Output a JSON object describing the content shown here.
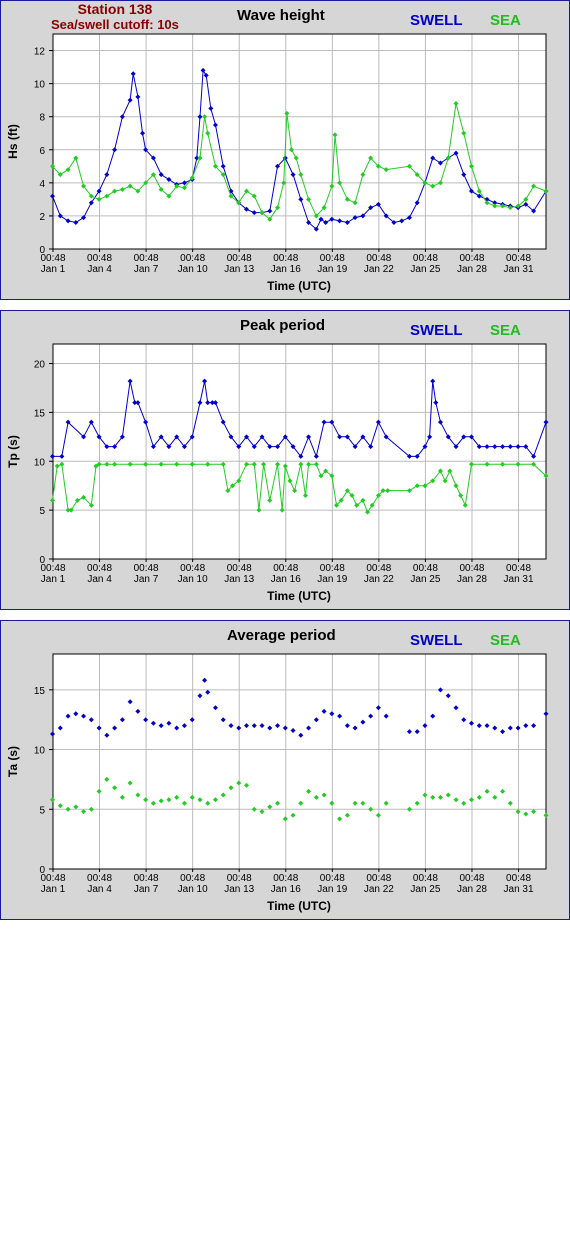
{
  "header": {
    "station": "Station 138",
    "cutoff": "Sea/swell cutoff: 10s"
  },
  "legend": {
    "swell": "SWELL",
    "sea": "SEA",
    "swell_color": "#0000cc",
    "sea_color": "#22bb22"
  },
  "colors": {
    "swell": "#0000cc",
    "sea": "#22cc22",
    "frame": "#1a1a99",
    "panel_bg": "#d6d6d6",
    "plot_bg": "#ffffff",
    "grid": "#bbbbbb"
  },
  "x_ticks": [
    {
      "time": "00:48",
      "date": "Jan 1"
    },
    {
      "time": "00:48",
      "date": "Jan 4"
    },
    {
      "time": "00:48",
      "date": "Jan 7"
    },
    {
      "time": "00:48",
      "date": "Jan 10"
    },
    {
      "time": "00:48",
      "date": "Jan 13"
    },
    {
      "time": "00:48",
      "date": "Jan 16"
    },
    {
      "time": "00:48",
      "date": "Jan 19"
    },
    {
      "time": "00:48",
      "date": "Jan 22"
    },
    {
      "time": "00:48",
      "date": "Jan 25"
    },
    {
      "time": "00:48",
      "date": "Jan 28"
    },
    {
      "time": "00:48",
      "date": "Jan 31"
    }
  ],
  "chart_data": [
    {
      "type": "line",
      "title": "Wave height",
      "xlabel": "Time (UTC)",
      "ylabel": "Hs (ft)",
      "ylim": [
        0,
        13
      ],
      "yticks": [
        0,
        2,
        4,
        6,
        8,
        10,
        12
      ],
      "xlim": [
        1.03,
        32.8
      ],
      "grid": true,
      "series": [
        {
          "name": "SWELL",
          "x": [
            1.0,
            1.5,
            2.0,
            2.5,
            3.0,
            3.5,
            4.0,
            4.5,
            5.0,
            5.5,
            6.0,
            6.2,
            6.5,
            6.8,
            7.0,
            7.5,
            8.0,
            8.5,
            9.0,
            9.5,
            10.0,
            10.3,
            10.5,
            10.7,
            10.9,
            11.2,
            11.5,
            12.0,
            12.5,
            13.0,
            13.5,
            14.0,
            14.5,
            15.0,
            15.5,
            16.0,
            16.5,
            17.0,
            17.5,
            18.0,
            18.3,
            18.6,
            19.0,
            19.5,
            20.0,
            20.5,
            21.0,
            21.5,
            22.0,
            22.5,
            23.0,
            23.5,
            24.0,
            24.5,
            25.0,
            25.5,
            26.0,
            26.5,
            27.0,
            27.5,
            28.0,
            28.5,
            29.0,
            29.5,
            30.0,
            30.5,
            31.0,
            31.5,
            32.0,
            32.8
          ],
          "y": [
            3.2,
            2.0,
            1.7,
            1.6,
            1.9,
            2.8,
            3.5,
            4.5,
            6.0,
            8.0,
            9.0,
            10.6,
            9.2,
            7.0,
            6.0,
            5.5,
            4.5,
            4.2,
            3.9,
            4.0,
            4.2,
            5.5,
            8.0,
            10.8,
            10.5,
            8.5,
            7.5,
            5.0,
            3.5,
            2.8,
            2.4,
            2.2,
            2.2,
            2.3,
            5.0,
            5.5,
            4.5,
            3.0,
            1.6,
            1.2,
            1.8,
            1.6,
            1.8,
            1.7,
            1.6,
            1.9,
            2.0,
            2.5,
            2.7,
            2.0,
            1.6,
            1.7,
            1.9,
            2.8,
            4.0,
            5.5,
            5.2,
            5.5,
            5.8,
            4.5,
            3.5,
            3.2,
            3.0,
            2.8,
            2.7,
            2.6,
            2.5,
            2.7,
            2.3,
            3.5
          ]
        },
        {
          "name": "SEA",
          "x": [
            1.0,
            1.5,
            2.0,
            2.5,
            3.0,
            3.5,
            4.0,
            4.5,
            5.0,
            5.5,
            6.0,
            6.5,
            7.0,
            7.5,
            8.0,
            8.5,
            9.0,
            9.5,
            10.0,
            10.5,
            10.8,
            11.0,
            11.5,
            12.0,
            12.5,
            13.0,
            13.5,
            14.0,
            14.5,
            15.0,
            15.5,
            15.9,
            16.1,
            16.4,
            16.7,
            17.0,
            17.5,
            18.0,
            18.5,
            19.0,
            19.2,
            19.5,
            20.0,
            20.5,
            21.0,
            21.5,
            22.0,
            22.5,
            24.0,
            24.5,
            25.0,
            25.5,
            26.0,
            26.5,
            27.0,
            27.5,
            28.0,
            28.5,
            29.0,
            29.5,
            30.0,
            30.5,
            31.0,
            31.5,
            32.0,
            32.8
          ],
          "y": [
            5.0,
            4.5,
            4.8,
            5.5,
            3.8,
            3.2,
            3.0,
            3.2,
            3.5,
            3.6,
            3.8,
            3.5,
            4.0,
            4.5,
            3.6,
            3.2,
            3.8,
            3.7,
            4.3,
            5.5,
            8.0,
            7.0,
            5.0,
            4.5,
            3.2,
            2.8,
            3.5,
            3.2,
            2.2,
            1.8,
            2.5,
            4.0,
            8.2,
            6.0,
            5.5,
            4.5,
            3.0,
            2.0,
            2.5,
            3.8,
            6.9,
            4.0,
            3.0,
            2.8,
            4.5,
            5.5,
            5.0,
            4.8,
            5.0,
            4.5,
            4.0,
            3.8,
            4.0,
            5.5,
            8.8,
            7.0,
            5.0,
            3.5,
            2.8,
            2.6,
            2.6,
            2.5,
            2.6,
            3.0,
            3.8,
            3.5
          ]
        }
      ]
    },
    {
      "type": "line",
      "title": "Peak period",
      "xlabel": "Time (UTC)",
      "ylabel": "Tp (s)",
      "ylim": [
        0,
        22
      ],
      "yticks": [
        0,
        5,
        10,
        15,
        20
      ],
      "xlim": [
        1.03,
        32.8
      ],
      "grid": true,
      "series": [
        {
          "name": "SWELL",
          "x": [
            1.0,
            1.6,
            2.0,
            3.0,
            3.5,
            4.0,
            4.5,
            5.0,
            5.5,
            6.0,
            6.3,
            6.5,
            7.0,
            7.5,
            8.0,
            8.5,
            9.0,
            9.5,
            10.0,
            10.5,
            10.8,
            11.0,
            11.3,
            11.5,
            12.0,
            12.5,
            13.0,
            13.5,
            14.0,
            14.5,
            15.0,
            15.5,
            16.0,
            16.5,
            17.0,
            17.5,
            18.0,
            18.5,
            19.0,
            19.5,
            20.0,
            20.5,
            21.0,
            21.5,
            22.0,
            22.5,
            24.0,
            24.5,
            25.0,
            25.3,
            25.5,
            25.7,
            26.0,
            26.5,
            27.0,
            27.5,
            28.0,
            28.5,
            29.0,
            29.5,
            30.0,
            30.5,
            31.0,
            31.5,
            32.0,
            32.8
          ],
          "y": [
            10.5,
            10.5,
            14.0,
            12.5,
            14.0,
            12.5,
            11.5,
            11.5,
            12.5,
            18.2,
            16.0,
            16.0,
            14.0,
            11.5,
            12.5,
            11.5,
            12.5,
            11.5,
            12.5,
            16.0,
            18.2,
            16.0,
            16.0,
            16.0,
            14.0,
            12.5,
            11.5,
            12.5,
            11.5,
            12.5,
            11.5,
            11.5,
            12.5,
            11.5,
            10.5,
            12.5,
            10.5,
            14.0,
            14.0,
            12.5,
            12.5,
            11.5,
            12.5,
            11.5,
            14.0,
            12.5,
            10.5,
            10.5,
            11.5,
            12.5,
            18.2,
            16.0,
            14.0,
            12.5,
            11.5,
            12.5,
            12.5,
            11.5,
            11.5,
            11.5,
            11.5,
            11.5,
            11.5,
            11.5,
            10.5,
            14.0
          ]
        },
        {
          "name": "SEA",
          "x": [
            1.0,
            1.3,
            1.6,
            2.0,
            2.2,
            2.6,
            3.0,
            3.5,
            3.8,
            4.0,
            4.5,
            5.0,
            6.0,
            7.0,
            8.0,
            9.0,
            10.0,
            11.0,
            12.0,
            12.3,
            12.6,
            13.0,
            13.5,
            14.0,
            14.3,
            14.6,
            15.0,
            15.5,
            15.8,
            16.0,
            16.3,
            16.6,
            17.0,
            17.3,
            17.5,
            18.0,
            18.3,
            18.6,
            19.0,
            19.3,
            19.6,
            20.0,
            20.3,
            20.6,
            21.0,
            21.3,
            21.6,
            22.0,
            22.3,
            22.6,
            24.0,
            24.5,
            25.0,
            25.5,
            26.0,
            26.3,
            26.6,
            27.0,
            27.3,
            27.6,
            28.0,
            29.0,
            30.0,
            31.0,
            32.0,
            32.8
          ],
          "y": [
            6.0,
            9.5,
            9.7,
            5.0,
            5.0,
            6.0,
            6.3,
            5.5,
            9.5,
            9.7,
            9.7,
            9.7,
            9.7,
            9.7,
            9.7,
            9.7,
            9.7,
            9.7,
            9.7,
            7.0,
            7.5,
            8.0,
            9.7,
            9.7,
            5.0,
            9.7,
            6.0,
            9.7,
            5.0,
            9.5,
            8.0,
            7.0,
            9.7,
            6.5,
            9.7,
            9.7,
            8.5,
            9.0,
            8.5,
            5.5,
            6.0,
            7.0,
            6.5,
            5.5,
            6.0,
            4.8,
            5.5,
            6.5,
            7.0,
            7.0,
            7.0,
            7.5,
            7.5,
            8.0,
            9.0,
            8.0,
            9.0,
            7.5,
            6.5,
            5.5,
            9.7,
            9.7,
            9.7,
            9.7,
            9.7,
            8.5
          ]
        }
      ]
    },
    {
      "type": "scatter",
      "title": "Average period",
      "xlabel": "Time (UTC)",
      "ylabel": "Ta (s)",
      "ylim": [
        0,
        18
      ],
      "yticks": [
        0,
        5,
        10,
        15
      ],
      "xlim": [
        1.03,
        32.8
      ],
      "grid": true,
      "series": [
        {
          "name": "SWELL",
          "x": [
            1.0,
            1.5,
            2.0,
            2.5,
            3.0,
            3.5,
            4.0,
            4.5,
            5.0,
            5.5,
            6.0,
            6.5,
            7.0,
            7.5,
            8.0,
            8.5,
            9.0,
            9.5,
            10.0,
            10.5,
            10.8,
            11.0,
            11.5,
            12.0,
            12.5,
            13.0,
            13.5,
            14.0,
            14.5,
            15.0,
            15.5,
            16.0,
            16.5,
            17.0,
            17.5,
            18.0,
            18.5,
            19.0,
            19.5,
            20.0,
            20.5,
            21.0,
            21.5,
            22.0,
            22.5,
            24.0,
            24.5,
            25.0,
            25.5,
            26.0,
            26.5,
            27.0,
            27.5,
            28.0,
            28.5,
            29.0,
            29.5,
            30.0,
            30.5,
            31.0,
            31.5,
            32.0,
            32.8
          ],
          "y": [
            11.3,
            11.8,
            12.8,
            13.0,
            12.8,
            12.5,
            11.8,
            11.2,
            11.8,
            12.5,
            14.0,
            13.2,
            12.5,
            12.2,
            12.0,
            12.2,
            11.8,
            12.0,
            12.5,
            14.5,
            15.8,
            14.8,
            13.5,
            12.5,
            12.0,
            11.8,
            12.0,
            12.0,
            12.0,
            11.8,
            12.0,
            11.8,
            11.6,
            11.2,
            11.8,
            12.5,
            13.2,
            13.0,
            12.8,
            12.0,
            11.8,
            12.3,
            12.8,
            13.5,
            12.8,
            11.5,
            11.5,
            12.0,
            12.8,
            15.0,
            14.5,
            13.5,
            12.5,
            12.2,
            12.0,
            12.0,
            11.8,
            11.5,
            11.8,
            11.8,
            12.0,
            12.0,
            13.0
          ]
        },
        {
          "name": "SEA",
          "x": [
            1.0,
            1.5,
            2.0,
            2.5,
            3.0,
            3.5,
            4.0,
            4.5,
            5.0,
            5.5,
            6.0,
            6.5,
            7.0,
            7.5,
            8.0,
            8.5,
            9.0,
            9.5,
            10.0,
            10.5,
            11.0,
            11.5,
            12.0,
            12.5,
            13.0,
            13.5,
            14.0,
            14.5,
            15.0,
            15.5,
            16.0,
            16.5,
            17.0,
            17.5,
            18.0,
            18.5,
            19.0,
            19.5,
            20.0,
            20.5,
            21.0,
            21.5,
            22.0,
            22.5,
            24.0,
            24.5,
            25.0,
            25.5,
            26.0,
            26.5,
            27.0,
            27.5,
            28.0,
            28.5,
            29.0,
            29.5,
            30.0,
            30.5,
            31.0,
            31.5,
            32.0,
            32.8
          ],
          "y": [
            5.8,
            5.3,
            5.0,
            5.2,
            4.8,
            5.0,
            6.5,
            7.5,
            6.8,
            6.0,
            7.2,
            6.2,
            5.8,
            5.5,
            5.7,
            5.8,
            6.0,
            5.5,
            6.0,
            5.8,
            5.5,
            5.8,
            6.2,
            6.8,
            7.2,
            7.0,
            5.0,
            4.8,
            5.2,
            5.5,
            4.2,
            4.5,
            5.5,
            6.5,
            6.0,
            6.2,
            5.5,
            4.2,
            4.5,
            5.5,
            5.5,
            5.0,
            4.5,
            5.5,
            5.0,
            5.5,
            6.2,
            6.0,
            6.0,
            6.2,
            5.8,
            5.5,
            5.8,
            6.0,
            6.5,
            6.0,
            6.5,
            5.5,
            4.8,
            4.6,
            4.8,
            4.5
          ]
        }
      ]
    }
  ]
}
